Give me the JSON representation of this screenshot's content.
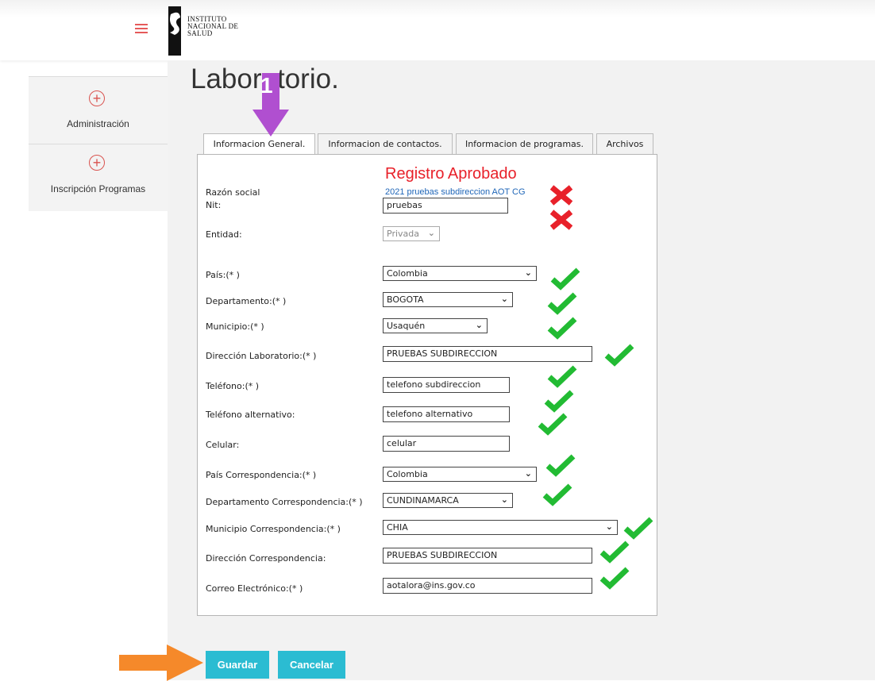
{
  "header": {
    "logo_lines": [
      "Instituto",
      "Nacional de",
      "Salud"
    ]
  },
  "sidebar": {
    "items": [
      {
        "label": "Administración"
      },
      {
        "label": "Inscripción Programas"
      }
    ]
  },
  "page": {
    "title": "Laboratorio."
  },
  "tabs": [
    {
      "label": "Informacion General.",
      "active": true
    },
    {
      "label": "Informacion de contactos.",
      "active": false
    },
    {
      "label": "Informacion de programas.",
      "active": false
    },
    {
      "label": "Archivos",
      "active": false
    }
  ],
  "form": {
    "status": "Registro Aprobado",
    "razon_social": {
      "label": "Razón social",
      "value": "2021 pruebas subdireccion AOT CG"
    },
    "nit": {
      "label": "Nit:",
      "value": "pruebas"
    },
    "entidad": {
      "label": "Entidad:",
      "value": "Privada"
    },
    "pais": {
      "label": "País:(* )",
      "value": "Colombia"
    },
    "departamento": {
      "label": "Departamento:(* )",
      "value": "BOGOTA"
    },
    "municipio": {
      "label": "Municipio:(* )",
      "value": "Usaquén"
    },
    "direccion_lab": {
      "label": "Dirección Laboratorio:(* )",
      "value": "PRUEBAS SUBDIRECCION"
    },
    "telefono": {
      "label": "Teléfono:(* )",
      "value": "telefono subdireccion"
    },
    "telefono_alt": {
      "label": "Teléfono alternativo:",
      "value": "telefono alternativo"
    },
    "celular": {
      "label": "Celular:",
      "value": "celular"
    },
    "pais_corr": {
      "label": "País Correspondencia:(* )",
      "value": "Colombia"
    },
    "departamento_corr": {
      "label": "Departamento Correspondencia:(* )",
      "value": "CUNDINAMARCA"
    },
    "municipio_corr": {
      "label": "Municipio Correspondencia:(* )",
      "value": "CHIA"
    },
    "direccion_corr": {
      "label": "Dirección Correspondencia:",
      "value": "PRUEBAS SUBDIRECCION"
    },
    "correo": {
      "label": "Correo Electrónico:(* )",
      "value": "aotalora@ins.gov.co"
    }
  },
  "buttons": {
    "save": "Guardar",
    "cancel": "Cancelar"
  },
  "annotations": {
    "step_number": "1",
    "arrow_purple": "#b04fd0",
    "arrow_orange": "#f5892a",
    "check_color": "#22bb33",
    "x_color": "#e8212a"
  }
}
